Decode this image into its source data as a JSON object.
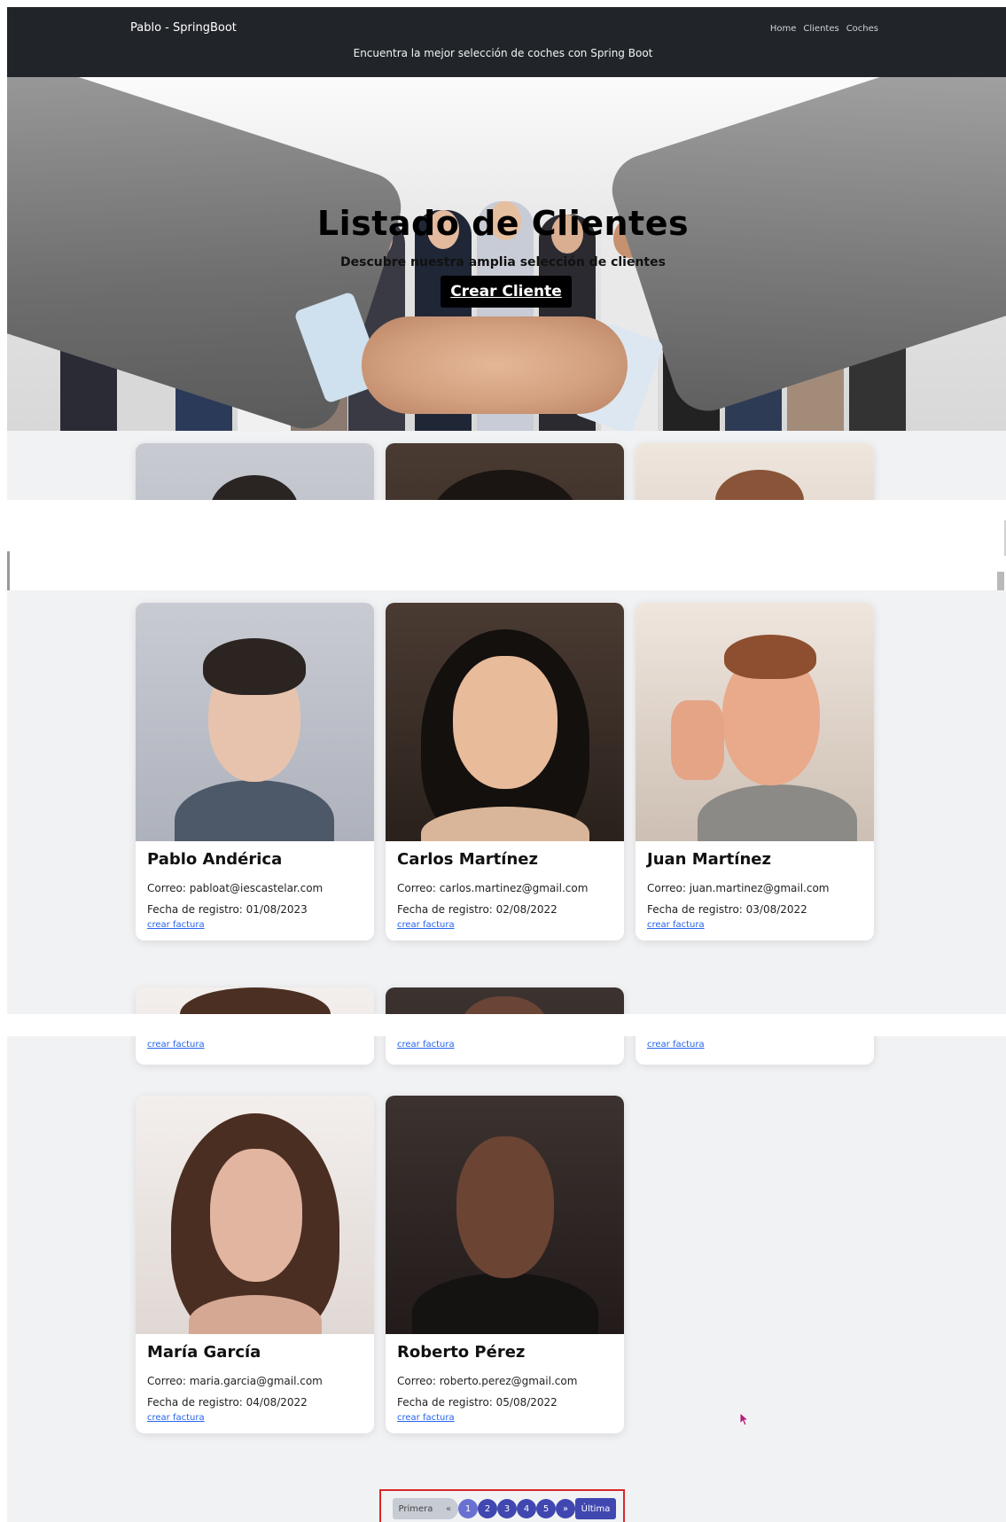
{
  "navbar": {
    "brand": "Pablo - SpringBoot",
    "links": [
      "Home",
      "Clientes",
      "Coches"
    ],
    "tagline": "Encuentra la mejor selección de coches con Spring Boot"
  },
  "hero": {
    "title": "Listado de Clientes",
    "subtitle": "Descubre nuestra amplia selección de clientes",
    "button": "Crear Cliente"
  },
  "clients": [
    {
      "name": "Pablo Andérica",
      "email": "Correo: pabloat@iescastelar.com",
      "date": "Fecha de registro: 01/08/2023",
      "link": "crear factura"
    },
    {
      "name": "Carlos Martínez",
      "email": "Correo: carlos.martinez@gmail.com",
      "date": "Fecha de registro: 02/08/2022",
      "link": "crear factura"
    },
    {
      "name": "Juan Martínez",
      "email": "Correo: juan.martinez@gmail.com",
      "date": "Fecha de registro: 03/08/2022",
      "link": "crear factura"
    },
    {
      "name": "María García",
      "email": "Correo: maria.garcia@gmail.com",
      "date": "Fecha de registro: 04/08/2022",
      "link": "crear factura"
    },
    {
      "name": "Roberto Pérez",
      "email": "Correo: roberto.perez@gmail.com",
      "date": "Fecha de registro: 05/08/2022",
      "link": "crear factura"
    }
  ],
  "fragment_links": [
    "crear factura",
    "crear factura",
    "crear factura"
  ],
  "pagination": {
    "first": "Primera",
    "prev": "«",
    "pages": [
      "1",
      "2",
      "3",
      "4",
      "5"
    ],
    "next": "»",
    "last": "Última",
    "current_page": "1"
  },
  "colors": {
    "navbar": "#212529",
    "section_bg": "#f1f2f4",
    "link": "#2563eb",
    "pager": "#4047b0",
    "highlight": "#dc2626"
  }
}
